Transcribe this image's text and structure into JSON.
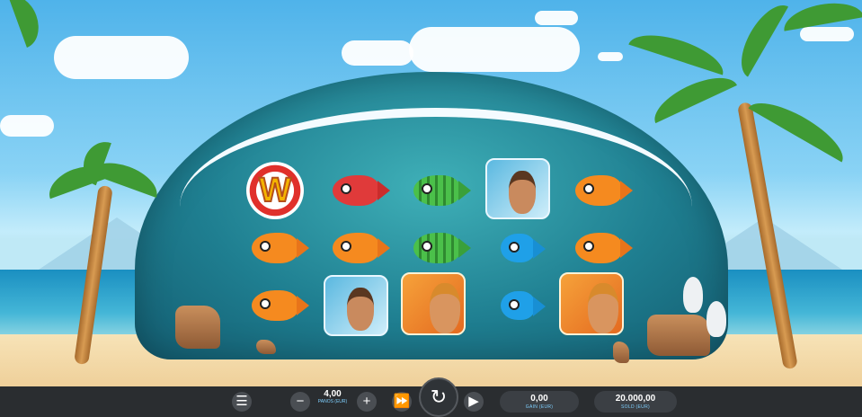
{
  "game": {
    "symbols": [
      {
        "reel": 1,
        "row": 1,
        "name": "wild-lifebuoy",
        "label": "W"
      },
      {
        "reel": 1,
        "row": 2,
        "name": "orange-fish"
      },
      {
        "reel": 1,
        "row": 3,
        "name": "orange-fish"
      },
      {
        "reel": 2,
        "row": 1,
        "name": "red-fish"
      },
      {
        "reel": 2,
        "row": 2,
        "name": "orange-fish"
      },
      {
        "reel": 2,
        "row": 3,
        "name": "surfer-girl"
      },
      {
        "reel": 3,
        "row": 1,
        "name": "green-fish"
      },
      {
        "reel": 3,
        "row": 2,
        "name": "green-fish"
      },
      {
        "reel": 3,
        "row": 3,
        "name": "surfer-man"
      },
      {
        "reel": 4,
        "row": 1,
        "name": "surfer-girl"
      },
      {
        "reel": 4,
        "row": 2,
        "name": "blue-fish"
      },
      {
        "reel": 4,
        "row": 3,
        "name": "blue-fish"
      },
      {
        "reel": 5,
        "row": 1,
        "name": "orange-fish"
      },
      {
        "reel": 5,
        "row": 2,
        "name": "orange-fish"
      },
      {
        "reel": 5,
        "row": 3,
        "name": "surfer-man"
      }
    ]
  },
  "controls": {
    "menu_icon": "hamburger-icon",
    "minus_label": "−",
    "plus_label": "+",
    "stake_value": "4,00",
    "stake_label": "PANOS (EUR)",
    "turbo_icon": "fast-forward-icon",
    "spin_icon": "↻",
    "autoplay_icon": "play-icon",
    "win_value": "0,00",
    "win_label": "GAIN (EUR)",
    "balance_value": "20.000,00",
    "balance_label": "SOLD (EUR)"
  },
  "colors": {
    "bar": "#2a2d30",
    "accent_label": "#7fd0ff",
    "wave": "#1f7f91"
  }
}
